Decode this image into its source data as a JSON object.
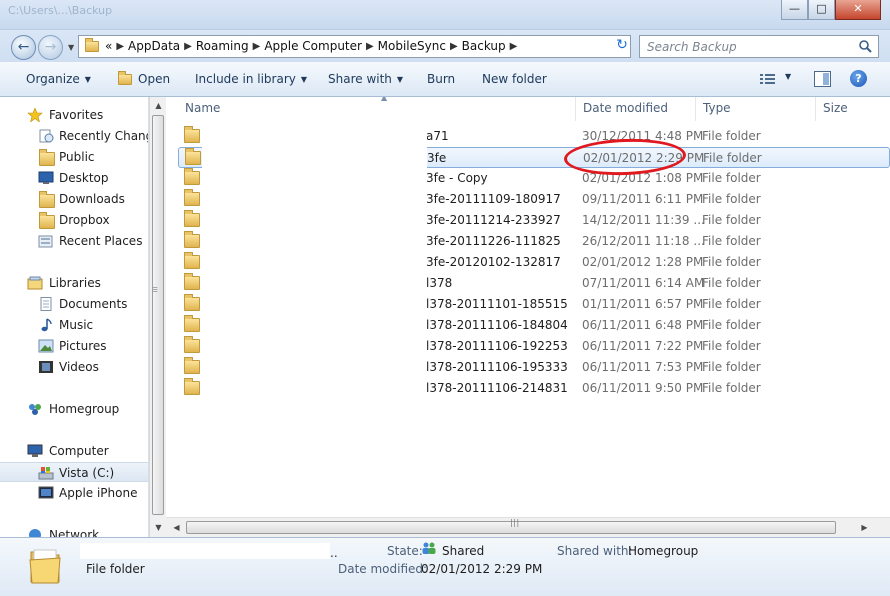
{
  "window": {
    "title": "C:\\Users\\...\\Backup",
    "controls": {
      "minimize": "—",
      "maximize": "□",
      "close": "✕"
    }
  },
  "address": {
    "overflow": "«",
    "crumbs": [
      "AppData",
      "Roaming",
      "Apple Computer",
      "MobileSync",
      "Backup"
    ],
    "search_placeholder": "Search Backup"
  },
  "toolbar": {
    "organize": "Organize",
    "open": "Open",
    "include_in_library": "Include in library",
    "share_with": "Share with",
    "burn": "Burn",
    "new_folder": "New folder"
  },
  "nav": {
    "favorites": {
      "header": "Favorites",
      "items": [
        "Recently Changed",
        "Public",
        "Desktop",
        "Downloads",
        "Dropbox",
        "Recent Places"
      ]
    },
    "libraries": {
      "header": "Libraries",
      "items": [
        "Documents",
        "Music",
        "Pictures",
        "Videos"
      ]
    },
    "homegroup": "Homegroup",
    "computer": {
      "header": "Computer",
      "items": [
        "Vista (C:)",
        "Apple iPhone"
      ]
    },
    "network": "Network"
  },
  "columns": {
    "name": "Name",
    "date_modified": "Date modified",
    "type": "Type",
    "size": "Size"
  },
  "files": [
    {
      "name": "a71",
      "date": "30/12/2011 4:48 PM",
      "type": "File folder"
    },
    {
      "name": "3fe",
      "date": "02/01/2012 2:29 PM",
      "type": "File folder",
      "selected": true
    },
    {
      "name": "3fe - Copy",
      "date": "02/01/2012 1:08 PM",
      "type": "File folder"
    },
    {
      "name": "3fe-20111109-180917",
      "date": "09/11/2011 6:11 PM",
      "type": "File folder"
    },
    {
      "name": "3fe-20111214-233927",
      "date": "14/12/2011 11:39 ...",
      "type": "File folder"
    },
    {
      "name": "3fe-20111226-111825",
      "date": "26/12/2011 11:18 ...",
      "type": "File folder"
    },
    {
      "name": "3fe-20120102-132817",
      "date": "02/01/2012 1:28 PM",
      "type": "File folder"
    },
    {
      "name": "l378",
      "date": "07/11/2011 6:14 AM",
      "type": "File folder"
    },
    {
      "name": "l378-20111101-185515",
      "date": "01/11/2011 6:57 PM",
      "type": "File folder"
    },
    {
      "name": "l378-20111106-184804",
      "date": "06/11/2011 6:48 PM",
      "type": "File folder"
    },
    {
      "name": "l378-20111106-192253",
      "date": "06/11/2011 7:22 PM",
      "type": "File folder"
    },
    {
      "name": "l378-20111106-195333",
      "date": "06/11/2011 7:53 PM",
      "type": "File folder"
    },
    {
      "name": "l378-20111106-214831",
      "date": "06/11/2011 9:50 PM",
      "type": "File folder"
    }
  ],
  "details": {
    "name_suffix": "..",
    "kind": "File folder",
    "state_label": "State:",
    "state_value": "Shared",
    "shared_with_label": "Shared with:",
    "shared_with_value": "Homegroup",
    "date_label": "Date modified:",
    "date_value": "02/01/2012 2:29 PM"
  },
  "colors": {
    "annotation_circle": "#e0191f",
    "selection": "#dcebfc"
  }
}
